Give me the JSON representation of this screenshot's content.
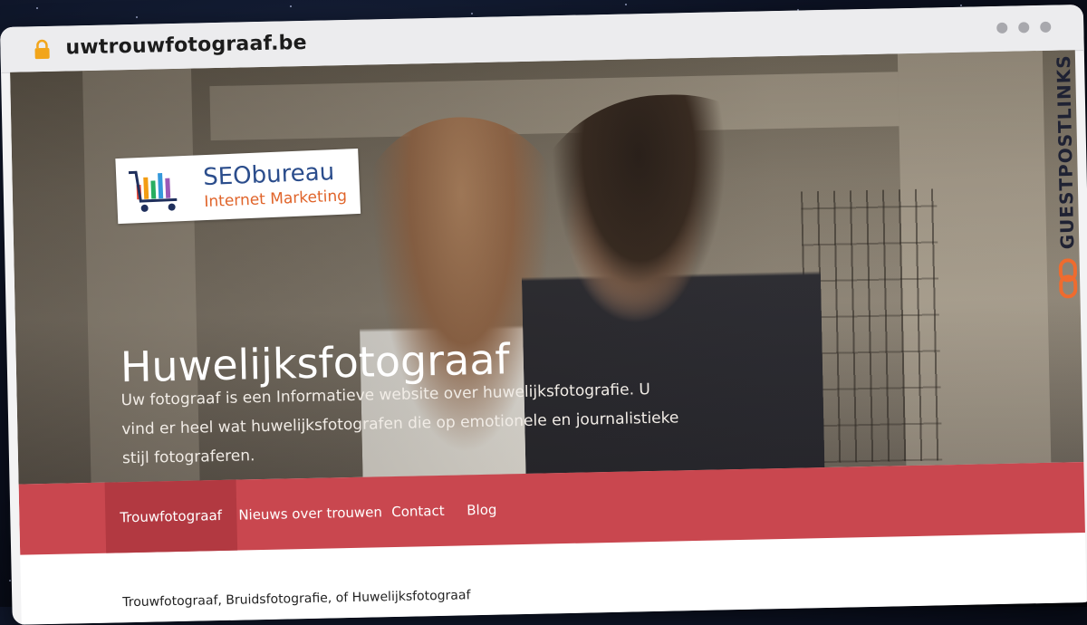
{
  "browser": {
    "url": "uwtrouwfotograaf.be"
  },
  "hero": {
    "title": "Huwelijksfotograaf",
    "description": "Uw fotograaf is een Informatieve website over huwelijksfotografie. U vind er heel wat huwelijksfotografen  die op emotionele en journalistieke stijl fotograferen."
  },
  "logo": {
    "line1": "SEObureau",
    "line2": "Internet Marketing"
  },
  "nav": {
    "items": [
      {
        "label": "Trouwfotograaf",
        "active": true
      },
      {
        "label": "Nieuws over trouwen",
        "active": false
      },
      {
        "label": "Contact",
        "active": false
      },
      {
        "label": "Blog",
        "active": false
      }
    ]
  },
  "content": {
    "heading": "Trouwfotograaf, Bruidsfotografie, of Huwelijksfotograaf"
  },
  "badge": {
    "text": "GUESTPOSTLINKS"
  },
  "colors": {
    "nav_bg": "#c9474f",
    "nav_active": "#b23941",
    "accent": "#e0642a"
  }
}
